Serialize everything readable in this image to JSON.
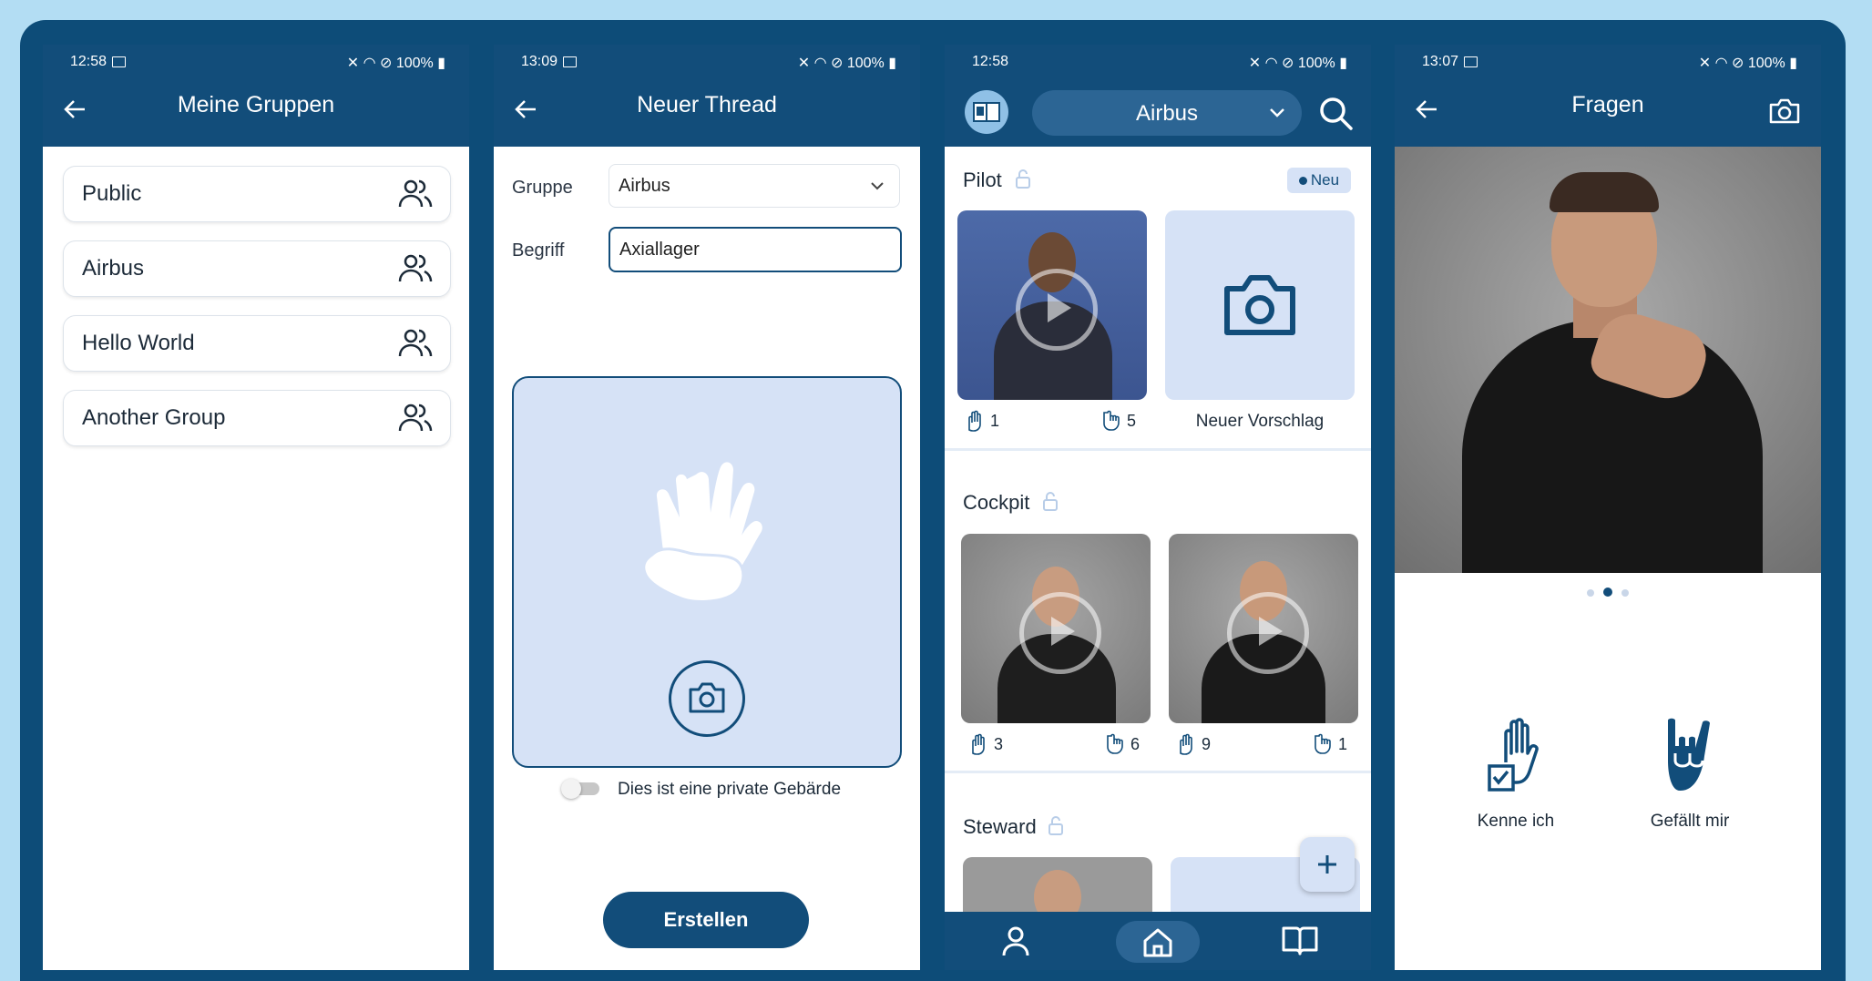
{
  "colors": {
    "background": "#b3ddf3",
    "frame": "#0d4c78",
    "appbar": "#124d7a",
    "tile": "#d6e2f6",
    "accent": "#124d7a"
  },
  "screen1": {
    "status": {
      "time": "12:58",
      "battery": "100%"
    },
    "title": "Meine Gruppen",
    "groups": [
      {
        "label": "Public",
        "icon": "group-icon"
      },
      {
        "label": "Airbus",
        "icon": "group-icon"
      },
      {
        "label": "Hello World",
        "icon": "group-icon"
      },
      {
        "label": "Another Group",
        "icon": "group-icon"
      }
    ]
  },
  "screen2": {
    "status": {
      "time": "13:09",
      "battery": "100%"
    },
    "title": "Neuer Thread",
    "group_label": "Gruppe",
    "group_value": "Airbus",
    "term_label": "Begriff",
    "term_value": "Axiallager",
    "private_toggle_label": "Dies ist eine private Gebärde",
    "private_toggle_on": false,
    "submit_label": "Erstellen"
  },
  "screen3": {
    "status": {
      "time": "12:58",
      "battery": "100%"
    },
    "group_selector": "Airbus",
    "sections": [
      {
        "title": "Pilot",
        "badge": "Neu",
        "videos": [
          {
            "known": "1",
            "likes": "5"
          }
        ],
        "suggestion_label": "Neuer Vorschlag"
      },
      {
        "title": "Cockpit",
        "videos": [
          {
            "known": "3",
            "likes": "6"
          },
          {
            "known": "9",
            "likes": "1"
          }
        ]
      },
      {
        "title": "Steward"
      }
    ],
    "nav": [
      "profile-icon",
      "home-icon",
      "book-icon"
    ]
  },
  "screen4": {
    "status": {
      "time": "13:07",
      "battery": "100%"
    },
    "title": "Fragen",
    "page_index": 2,
    "page_count": 3,
    "actions": [
      {
        "label": "Kenne ich"
      },
      {
        "label": "Gefällt mir"
      }
    ]
  }
}
